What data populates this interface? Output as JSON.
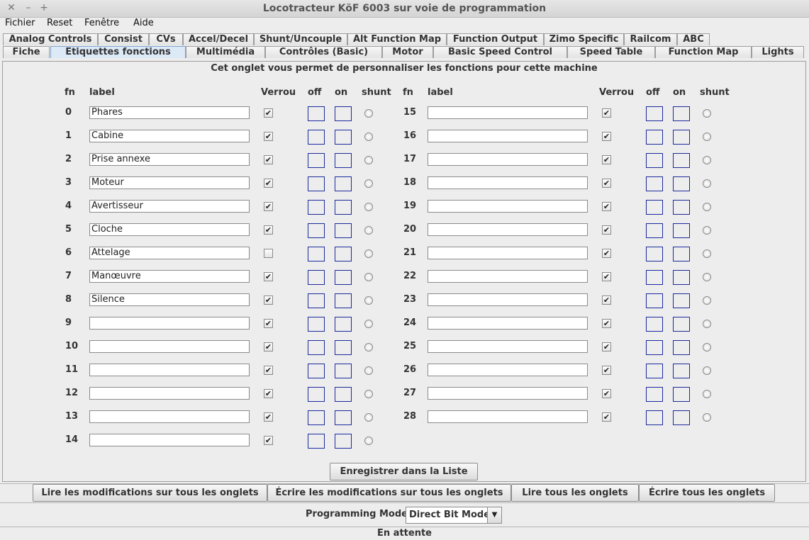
{
  "window": {
    "title": "Locotracteur KöF 6003 sur voie de programmation",
    "close_glyph": "✕",
    "minimize_glyph": "–",
    "maximize_glyph": "+"
  },
  "menu": [
    "Fichier",
    "Reset",
    "Fenêtre",
    "Aide"
  ],
  "tabs_row1": [
    "Analog Controls",
    "Consist",
    "CVs",
    "Accel/Decel",
    "Shunt/Uncouple",
    "Alt Function Map",
    "Function Output",
    "Zimo Specific",
    "Railcom",
    "ABC"
  ],
  "tabs_row2": [
    "Fiche",
    "Etiquettes fonctions",
    "Multimédia",
    "Contrôles (Basic)",
    "Motor",
    "Basic Speed Control",
    "Speed Table",
    "Function Map",
    "Lights"
  ],
  "active_tab": "Etiquettes fonctions",
  "panel": {
    "description": "Cet onglet vous permet de personnaliser les fonctions pour cette machine",
    "headers": {
      "fn": "fn",
      "label": "label",
      "lock": "Verrou",
      "off": "off",
      "on": "on",
      "shunt": "shunt"
    },
    "functions_left": [
      {
        "fn": "0",
        "label": "Phares",
        "lock": true
      },
      {
        "fn": "1",
        "label": "Cabine",
        "lock": true
      },
      {
        "fn": "2",
        "label": "Prise annexe",
        "lock": true
      },
      {
        "fn": "3",
        "label": "Moteur",
        "lock": true
      },
      {
        "fn": "4",
        "label": "Avertisseur",
        "lock": true
      },
      {
        "fn": "5",
        "label": "Cloche",
        "lock": true
      },
      {
        "fn": "6",
        "label": "Attelage",
        "lock": false
      },
      {
        "fn": "7",
        "label": "Manœuvre",
        "lock": true
      },
      {
        "fn": "8",
        "label": "Silence",
        "lock": true
      },
      {
        "fn": "9",
        "label": "",
        "lock": true
      },
      {
        "fn": "10",
        "label": "",
        "lock": true
      },
      {
        "fn": "11",
        "label": "",
        "lock": true
      },
      {
        "fn": "12",
        "label": "",
        "lock": true
      },
      {
        "fn": "13",
        "label": "",
        "lock": true
      },
      {
        "fn": "14",
        "label": "",
        "lock": true
      }
    ],
    "functions_right": [
      {
        "fn": "15",
        "label": "",
        "lock": true
      },
      {
        "fn": "16",
        "label": "",
        "lock": true
      },
      {
        "fn": "17",
        "label": "",
        "lock": true
      },
      {
        "fn": "18",
        "label": "",
        "lock": true
      },
      {
        "fn": "19",
        "label": "",
        "lock": true
      },
      {
        "fn": "20",
        "label": "",
        "lock": true
      },
      {
        "fn": "21",
        "label": "",
        "lock": true
      },
      {
        "fn": "22",
        "label": "",
        "lock": true
      },
      {
        "fn": "23",
        "label": "",
        "lock": true
      },
      {
        "fn": "24",
        "label": "",
        "lock": true
      },
      {
        "fn": "25",
        "label": "",
        "lock": true
      },
      {
        "fn": "26",
        "label": "",
        "lock": true
      },
      {
        "fn": "27",
        "label": "",
        "lock": true
      },
      {
        "fn": "28",
        "label": "",
        "lock": true
      }
    ],
    "save_button": "Enregistrer dans la Liste"
  },
  "bottom_buttons": [
    "Lire les modifications sur tous les onglets",
    "Écrire les modifications sur tous les onglets",
    "Lire tous les onglets",
    "Écrire tous les onglets"
  ],
  "programming_mode": {
    "label": "Programming Mode",
    "value": "Direct Bit Mode"
  },
  "status": "En attente",
  "colors": {
    "active_tab": "#dce9f7",
    "icon_box_border": "#1c2a9c"
  },
  "icons": {
    "check": "✔",
    "dropdown_arrow": "▼"
  }
}
